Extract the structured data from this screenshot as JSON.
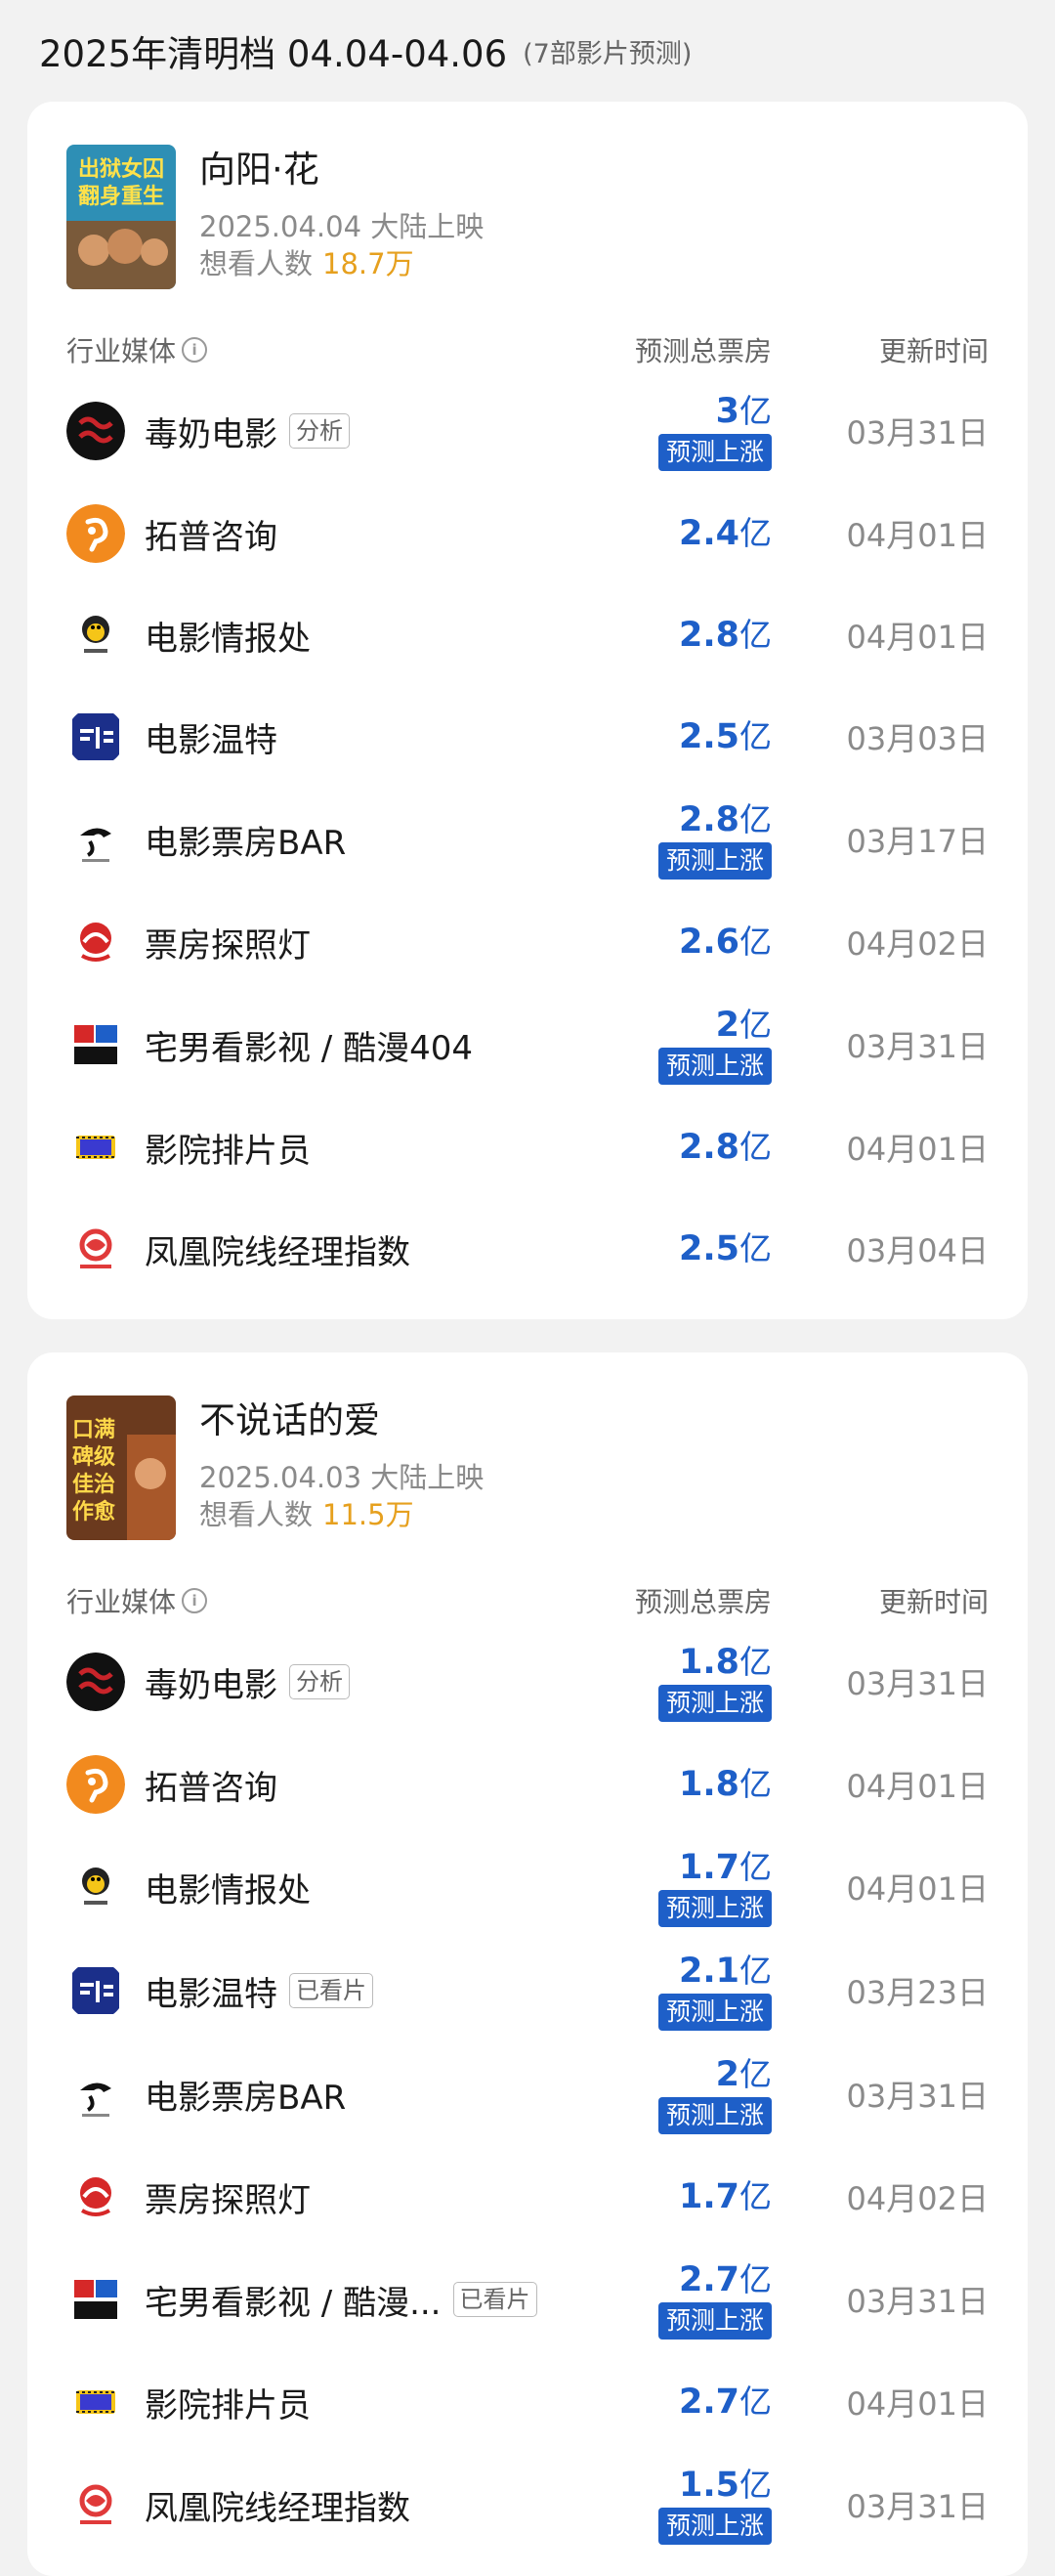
{
  "header": {
    "title": "2025年清明档 04.04-04.06",
    "sub": "(7部影片预测)"
  },
  "columns": {
    "media": "行业媒体",
    "info_icon": "i",
    "forecast": "预测总票房",
    "updated": "更新时间"
  },
  "movies": [
    {
      "title": "向阳·花",
      "date": "2025.04.04 大陆上映",
      "want_label": "想看人数",
      "want": "18.7万",
      "poster_text": [
        "出狱女囚",
        "翻身重生"
      ],
      "rows": [
        {
          "name": "毒奶电影",
          "tag": "分析",
          "value": "3",
          "unit": "亿",
          "badge": "预测上涨",
          "date": "03月31日"
        },
        {
          "name": "拓普咨询",
          "tag": "",
          "value": "2.4",
          "unit": "亿",
          "badge": "",
          "date": "04月01日"
        },
        {
          "name": "电影情报处",
          "tag": "",
          "value": "2.8",
          "unit": "亿",
          "badge": "",
          "date": "04月01日"
        },
        {
          "name": "电影温特",
          "tag": "",
          "value": "2.5",
          "unit": "亿",
          "badge": "",
          "date": "03月03日"
        },
        {
          "name": "电影票房BAR",
          "tag": "",
          "value": "2.8",
          "unit": "亿",
          "badge": "预测上涨",
          "date": "03月17日"
        },
        {
          "name": "票房探照灯",
          "tag": "",
          "value": "2.6",
          "unit": "亿",
          "badge": "",
          "date": "04月02日"
        },
        {
          "name": "宅男看影视 / 酷漫404",
          "tag": "",
          "value": "2",
          "unit": "亿",
          "badge": "预测上涨",
          "date": "03月31日"
        },
        {
          "name": "影院排片员",
          "tag": "",
          "value": "2.8",
          "unit": "亿",
          "badge": "",
          "date": "04月01日"
        },
        {
          "name": "凤凰院线经理指数",
          "tag": "",
          "value": "2.5",
          "unit": "亿",
          "badge": "",
          "date": "03月04日"
        }
      ]
    },
    {
      "title": "不说话的爱",
      "date": "2025.04.03 大陆上映",
      "want_label": "想看人数",
      "want": "11.5万",
      "poster_text": [
        "口满",
        "碑级",
        "佳治",
        "作愈"
      ],
      "rows": [
        {
          "name": "毒奶电影",
          "tag": "分析",
          "value": "1.8",
          "unit": "亿",
          "badge": "预测上涨",
          "date": "03月31日"
        },
        {
          "name": "拓普咨询",
          "tag": "",
          "value": "1.8",
          "unit": "亿",
          "badge": "",
          "date": "04月01日"
        },
        {
          "name": "电影情报处",
          "tag": "",
          "value": "1.7",
          "unit": "亿",
          "badge": "预测上涨",
          "date": "04月01日"
        },
        {
          "name": "电影温特",
          "tag": "已看片",
          "value": "2.1",
          "unit": "亿",
          "badge": "预测上涨",
          "date": "03月23日"
        },
        {
          "name": "电影票房BAR",
          "tag": "",
          "value": "2",
          "unit": "亿",
          "badge": "预测上涨",
          "date": "03月31日"
        },
        {
          "name": "票房探照灯",
          "tag": "",
          "value": "1.7",
          "unit": "亿",
          "badge": "",
          "date": "04月02日"
        },
        {
          "name": "宅男看影视 / 酷漫...",
          "tag": "已看片",
          "value": "2.7",
          "unit": "亿",
          "badge": "预测上涨",
          "date": "03月31日"
        },
        {
          "name": "影院排片员",
          "tag": "",
          "value": "2.7",
          "unit": "亿",
          "badge": "",
          "date": "04月01日"
        },
        {
          "name": "凤凰院线经理指数",
          "tag": "",
          "value": "1.5",
          "unit": "亿",
          "badge": "预测上涨",
          "date": "03月31日"
        }
      ]
    }
  ],
  "logos": [
    "duniu-logo-icon",
    "tuopu-logo-icon",
    "qingbao-logo-icon",
    "wente-logo-icon",
    "bar-logo-icon",
    "tanzhaodeng-logo-icon",
    "zhainan-logo-icon",
    "paipian-logo-icon",
    "fenghuang-logo-icon"
  ],
  "colors": {
    "accent": "#1e5fc8",
    "want": "#e6a01e",
    "muted": "#8a8a8a"
  }
}
